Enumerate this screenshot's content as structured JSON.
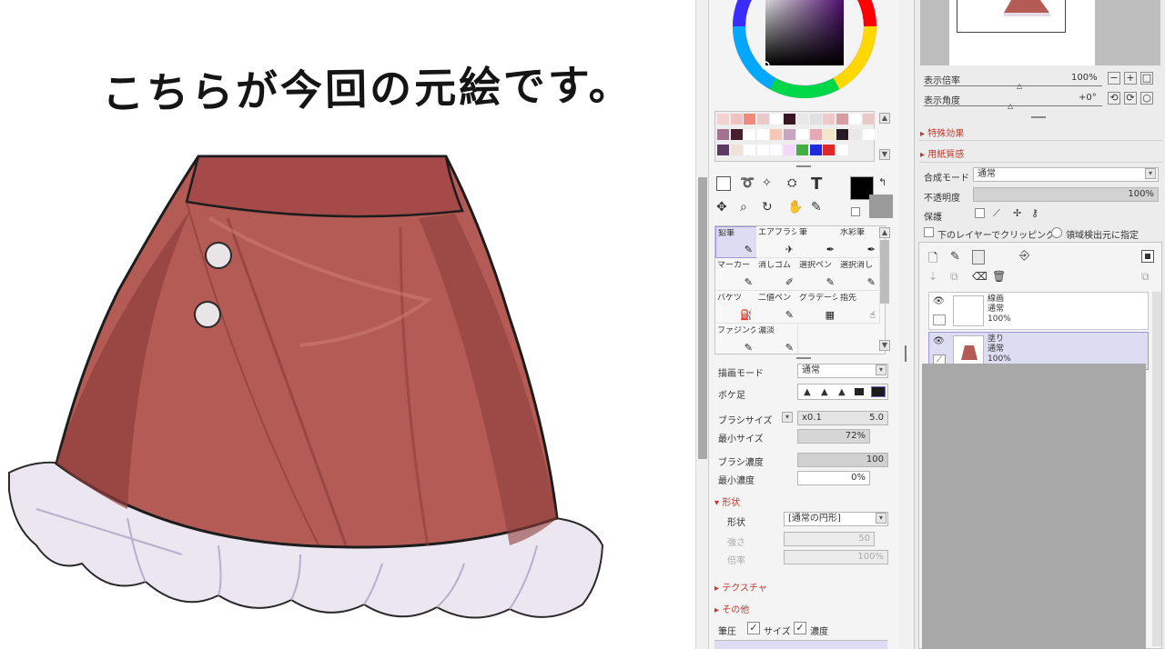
{
  "caption": "こちらが今回の元絵です。",
  "colors": {
    "skirt_body": "#b55b55",
    "skirt_shadow": "#8e3d3c",
    "frill": "#ece6f0",
    "selection": "#dcdcf3",
    "accent_red": "#c0392b"
  },
  "palette": [
    "#f3d2d2",
    "#f1c1c1",
    "#f08a7c",
    "#e9c9c9",
    "#fff",
    "#3a1525",
    "#e8e8e8",
    "#e0e0e0",
    "#efc9c9",
    "#d59ca1",
    "#fff",
    "#e8c8c8",
    "#a07490",
    "#4a1d2e",
    "#fff",
    "#fff",
    "#f4c8b7",
    "#c8a5c0",
    "#fff",
    "#e5a7b4",
    "#f4e6c8",
    "#2a1a26",
    "#e8e8e8",
    "#fff",
    "#5a3a60",
    "#f0e2d8",
    "#fff",
    "#fff",
    "#fff",
    "#f4d7ff",
    "#41b041",
    "#1d2bdc",
    "#e02828",
    "#fff"
  ],
  "tools": {
    "icons": [
      "marquee-icon",
      "lasso-icon",
      "magic-wand-icon",
      "eyedropper-bucket-icon",
      "text-icon",
      "move-icon",
      "zoom-icon",
      "rotate-icon",
      "hand-icon",
      "dropper-icon"
    ],
    "text_glyph": "T",
    "brushes": [
      {
        "label": "鉛筆",
        "selected": true
      },
      {
        "label": "エアブラシ",
        "selected": false
      },
      {
        "label": "筆",
        "selected": false
      },
      {
        "label": "水彩筆",
        "selected": false
      },
      {
        "label": "マーカー",
        "selected": false
      },
      {
        "label": "消しゴム",
        "selected": false
      },
      {
        "label": "選択ペン",
        "selected": false
      },
      {
        "label": "選択消し",
        "selected": false
      },
      {
        "label": "バケツ",
        "selected": false
      },
      {
        "label": "二値ペン",
        "selected": false
      },
      {
        "label": "グラデーション",
        "selected": false
      },
      {
        "label": "指先",
        "selected": false
      },
      {
        "label": "ファジングタッチ",
        "selected": false
      },
      {
        "label": "濃淡",
        "selected": false
      }
    ]
  },
  "brush_settings": {
    "blend_mode_label": "描画モード",
    "blend_mode_value": "通常",
    "blur_label": "ボケ足",
    "size_label": "ブラシサイズ",
    "size_multiplier": "x0.1",
    "size_value": "5.0",
    "min_size_label": "最小サイズ",
    "min_size_value": "72%",
    "density_label": "ブラシ濃度",
    "density_value": "100",
    "min_density_label": "最小濃度",
    "min_density_value": "0%",
    "shape_header": "形状",
    "shape_label": "形状",
    "shape_value": "[通常の円形]",
    "shape_sub1_label": "強さ",
    "shape_sub1_value": "50",
    "shape_sub2_label": "倍率",
    "shape_sub2_value": "100%",
    "texture_header": "テクスチャ",
    "other_header": "その他",
    "pressure_label": "筆圧",
    "pressure_size": "サイズ",
    "pressure_density": "濃度"
  },
  "view": {
    "zoom_label": "表示倍率",
    "zoom_value": "100%",
    "angle_label": "表示角度",
    "angle_value": "+0°",
    "zoom_buttons": [
      "−",
      "+",
      "□"
    ],
    "angle_buttons": [
      "⟲",
      "⟳",
      "○"
    ]
  },
  "sections": {
    "special_effects": "特殊効果",
    "paper_texture": "用紙質感"
  },
  "layer_settings": {
    "blend_label": "合成モード",
    "blend_value": "通常",
    "opacity_label": "不透明度",
    "opacity_value": "100%",
    "protect_label": "保護",
    "clip_label": "下のレイヤーでクリッピング",
    "source_label": "領域検出元に指定"
  },
  "layers": [
    {
      "name": "線画",
      "mode": "通常",
      "opacity": "100%",
      "selected": false
    },
    {
      "name": "塗り",
      "mode": "通常",
      "opacity": "100%",
      "selected": true
    }
  ]
}
